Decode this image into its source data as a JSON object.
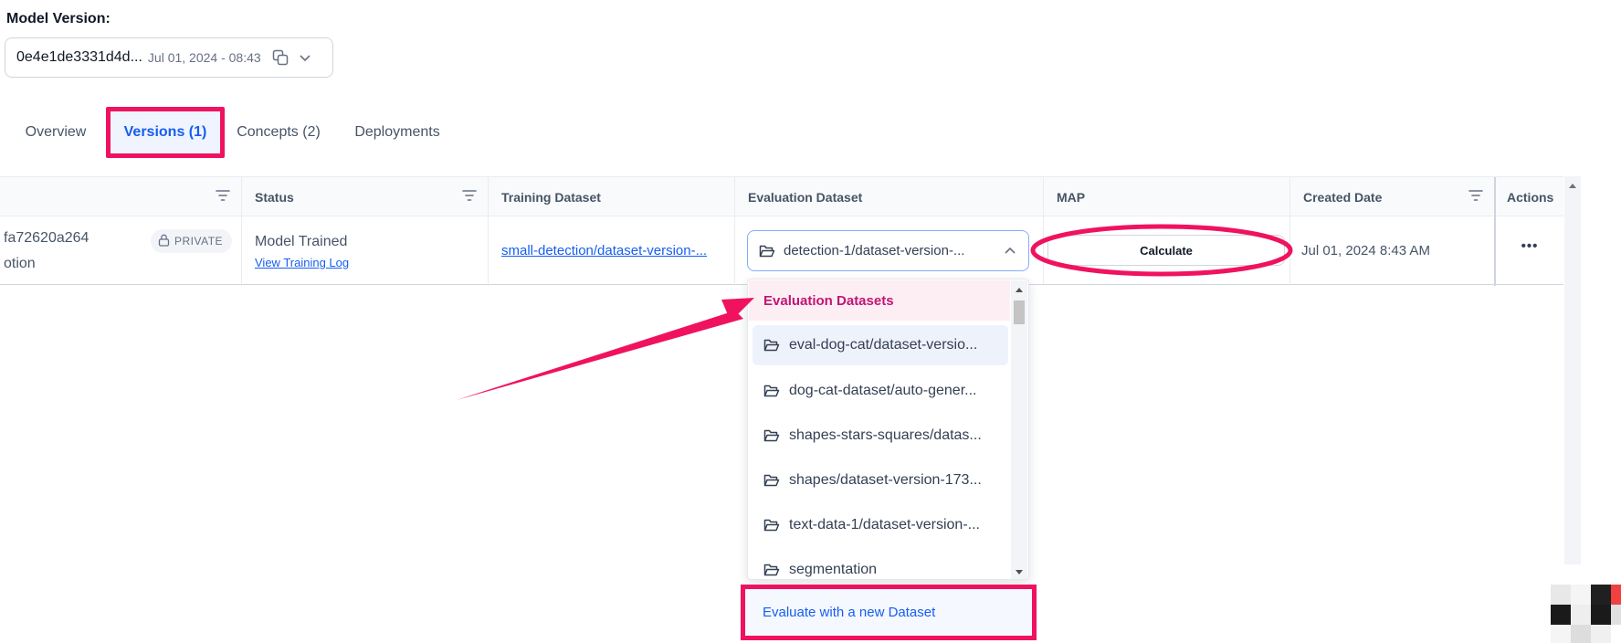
{
  "model_version": {
    "label": "Model Version:",
    "id": "0e4e1de3331d4d...",
    "date": "Jul 01, 2024 - 08:43"
  },
  "tabs": [
    {
      "label": "Overview"
    },
    {
      "label": "Versions (1)"
    },
    {
      "label": "Concepts (2)"
    },
    {
      "label": "Deployments"
    }
  ],
  "table": {
    "headers": {
      "status": "Status",
      "training": "Training Dataset",
      "evaluation": "Evaluation Dataset",
      "map": "MAP",
      "created": "Created Date",
      "actions": "Actions"
    },
    "row": {
      "version_id": "fa72620a264",
      "description": "otion",
      "badge": "PRIVATE",
      "status": "Model Trained",
      "status_link": "View Training Log",
      "training_dataset": "small-detection/dataset-version-...",
      "evaluation_dataset": "detection-1/dataset-version-...",
      "map_button": "Calculate",
      "created_date": "Jul 01, 2024 8:43 AM",
      "actions_icon": "•••"
    }
  },
  "dropdown": {
    "header": "Evaluation Datasets",
    "items": [
      {
        "label": "eval-dog-cat/dataset-versio...",
        "icon": "folder-open-icon"
      },
      {
        "label": "dog-cat-dataset/auto-gener...",
        "icon": "folder-open-icon"
      },
      {
        "label": "shapes-stars-squares/datas...",
        "icon": "folder-open-icon"
      },
      {
        "label": "shapes/dataset-version-173...",
        "icon": "folder-open-icon"
      },
      {
        "label": "text-data-1/dataset-version-...",
        "icon": "folder-open-icon"
      },
      {
        "label": "segmentation",
        "icon": "folder-open-icon"
      }
    ],
    "footer": "Evaluate with a new Dataset"
  },
  "colors": {
    "accent": "#155eef",
    "annotation": "#f0125f",
    "header_tint": "#c11574"
  }
}
